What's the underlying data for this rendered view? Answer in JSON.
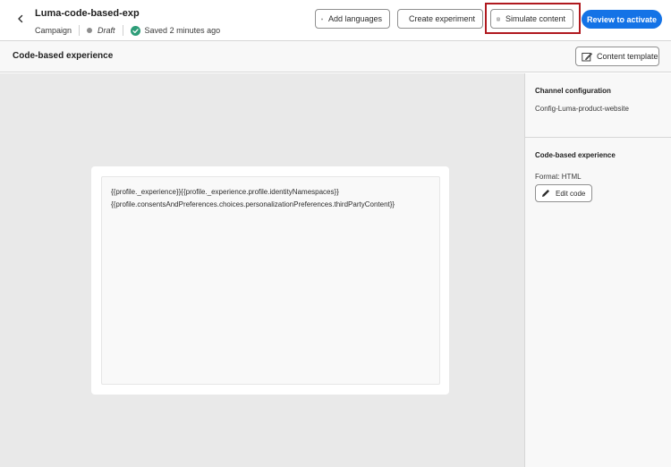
{
  "header": {
    "title": "Luma-code-based-exp",
    "type": "Campaign",
    "status": "Draft",
    "saved_text": "Saved 2 minutes ago",
    "buttons": {
      "add_languages": "Add languages",
      "create_experiment": "Create experiment",
      "simulate_content": "Simulate content",
      "review_to_activate": "Review to activate"
    }
  },
  "subheader": {
    "title": "Code-based experience",
    "content_template": "Content template"
  },
  "editor": {
    "line1": "{{profile._experience}}{{profile._experience.profile.identityNamespaces}}",
    "line2": "{{profile.consentsAndPreferences.choices.personalizationPreferences.thirdPartyContent}}"
  },
  "panel": {
    "channel_heading": "Channel configuration",
    "channel_value": "Config-Luma-product-website",
    "cbe_heading": "Code-based experience",
    "format": "Format: HTML",
    "edit_code": "Edit code"
  },
  "colors": {
    "primary": "#1473e6",
    "highlight": "#b0191f",
    "saved_check": "#2d9d78",
    "canvas_bg": "#e9e9e9"
  }
}
